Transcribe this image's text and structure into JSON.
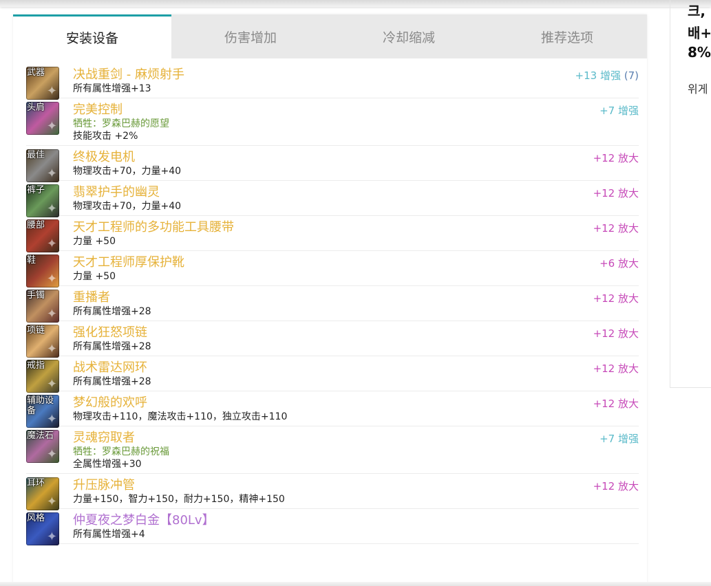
{
  "tabs": [
    "安装设备",
    "伤害增加",
    "冷却缩减",
    "推荐选项"
  ],
  "colors": {
    "accent": "#1d9fa6",
    "item_name": "#e6b23a",
    "enhance": "#5abac9",
    "amplify": "#c648b8",
    "sacrifice": "#6a9a3a",
    "purple_item": "#b070d0"
  },
  "items": [
    {
      "slot": "武器",
      "name": "决战重剑 - 麻烦射手",
      "subs": [],
      "attrs": [
        "所有属性增强+13"
      ],
      "amp": "+13 增强",
      "amp_count": "(7)",
      "amp_type": "cyan",
      "icon_bg": "linear-gradient(135deg,#5a3a1a,#c9a060,#3a2a1a)"
    },
    {
      "slot": "头肩",
      "name": "完美控制",
      "subs": [
        "牺牲：罗森巴赫的愿望"
      ],
      "attrs": [
        "技能攻击 +2%"
      ],
      "amp": "+7 增强",
      "amp_count": "",
      "amp_type": "cyan",
      "icon_bg": "linear-gradient(135deg,#2f4a6a,#c05aa0,#3c6a3a)"
    },
    {
      "slot": "最佳",
      "name": "终极发电机",
      "subs": [],
      "attrs": [
        "物理攻击+70，力量+40"
      ],
      "amp": "+12 放大",
      "amp_count": "",
      "amp_type": "pink",
      "icon_bg": "linear-gradient(135deg,#4a3a20,#8a8a8a,#3a2a1a)"
    },
    {
      "slot": "裤子",
      "name": "翡翠护手的幽灵",
      "subs": [],
      "attrs": [
        "物理攻击+70，力量+40"
      ],
      "amp": "+12 放大",
      "amp_count": "",
      "amp_type": "pink",
      "icon_bg": "linear-gradient(135deg,#1a2a1a,#6a9a5a,#2a2a2a)"
    },
    {
      "slot": "腰部",
      "name": "天才工程师的多功能工具腰带",
      "subs": [],
      "attrs": [
        "力量 +50"
      ],
      "amp": "+12 放大",
      "amp_count": "",
      "amp_type": "pink",
      "icon_bg": "linear-gradient(135deg,#5a2a1a,#b04030,#3a2a1a)"
    },
    {
      "slot": "鞋",
      "name": "天才工程师厚保护靴",
      "subs": [],
      "attrs": [
        "力量 +50"
      ],
      "amp": "+6 放大",
      "amp_count": "",
      "amp_type": "pink",
      "icon_bg": "linear-gradient(135deg,#3a2a1a,#a04030,#e0a040)"
    },
    {
      "slot": "手镯",
      "name": "重播者",
      "subs": [],
      "attrs": [
        "所有属性增强+28"
      ],
      "amp": "+12 放大",
      "amp_count": "",
      "amp_type": "pink",
      "icon_bg": "linear-gradient(135deg,#3a2a2a,#c09060,#5a2a2a)"
    },
    {
      "slot": "项链",
      "name": "强化狂怒项链",
      "subs": [],
      "attrs": [
        "所有属性增强+28"
      ],
      "amp": "+12 放大",
      "amp_count": "",
      "amp_type": "pink",
      "icon_bg": "linear-gradient(135deg,#5a3a1a,#e0b070,#4a2a1a)"
    },
    {
      "slot": "戒指",
      "name": "战术雷达网环",
      "subs": [],
      "attrs": [
        "所有属性增强+28"
      ],
      "amp": "+12 放大",
      "amp_count": "",
      "amp_type": "pink",
      "icon_bg": "linear-gradient(135deg,#2a2a1a,#c0a040,#3a3a2a)"
    },
    {
      "slot": "辅助设备",
      "name": "梦幻般的欢呼",
      "subs": [],
      "attrs": [
        "物理攻击+110，魔法攻击+110，独立攻击+110"
      ],
      "amp": "+12 放大",
      "amp_count": "",
      "amp_type": "pink",
      "icon_bg": "linear-gradient(135deg,#3a3a3a,#4a7ac0,#1a1a2a)"
    },
    {
      "slot": "魔法石",
      "name": "灵魂窃取者",
      "subs": [
        "牺牲：罗森巴赫的祝福"
      ],
      "attrs": [
        "全属性增强+30"
      ],
      "amp": "+7 增强",
      "amp_count": "",
      "amp_type": "cyan",
      "icon_bg": "linear-gradient(135deg,#2a4a3a,#b06aa0,#3a5a2a)"
    },
    {
      "slot": "耳环",
      "name": "升压脉冲管",
      "subs": [],
      "attrs": [
        "力量+150，智力+150，耐力+150，精神+150"
      ],
      "amp": "+12 放大",
      "amp_count": "",
      "amp_type": "pink",
      "icon_bg": "linear-gradient(135deg,#1a4a5a,#d0a030,#3a3a1a)"
    },
    {
      "slot": "风格",
      "name": "仲夏夜之梦白金【80Lv】",
      "subs": [],
      "attrs": [
        "所有属性增强+4"
      ],
      "amp": "",
      "amp_count": "",
      "amp_type": "cyan",
      "name_color": "purple",
      "icon_bg": "linear-gradient(135deg,#1a2a6a,#3a5ac0,#1a1a4a)"
    }
  ],
  "right": {
    "lines": [
      "크,",
      "배+",
      "8%"
    ],
    "small": "위게"
  }
}
